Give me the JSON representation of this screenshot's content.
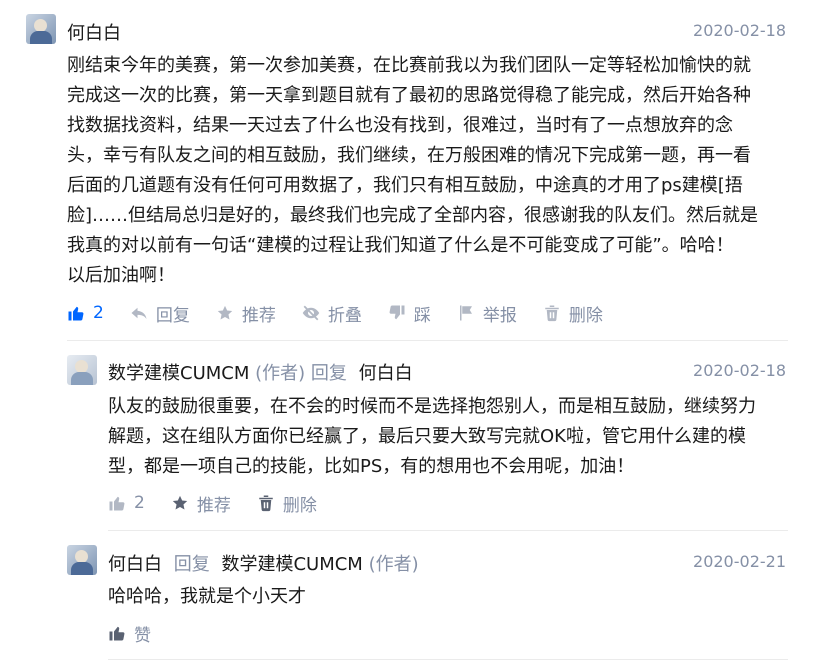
{
  "comment1": {
    "author": "何白白",
    "date": "2020-02-18",
    "lines": [
      "刚结束今年的美赛，第一次参加美赛，在比赛前我以为我们团队一定等轻松加愉快的就",
      "完成这一次的比赛，第一天拿到题目就有了最初的思路觉得稳了能完成，然后开始各种",
      "找数据找资料，结果一天过去了什么也没有找到，很难过，当时有了一点想放弃的念",
      "头，幸亏有队友之间的相互鼓励，我们继续，在万般困难的情况下完成第一题，再一看",
      "后面的几道题有没有任何可用数据了，我们只有相互鼓励，中途真的才用了ps建模[捂",
      "脸]……但结局总归是好的，最终我们也完成了全部内容，很感谢我的队友们。然后就是",
      "我真的对以前有一句话“建模的过程让我们知道了什么是不可能变成了可能”。哈哈！",
      "以后加油啊！"
    ],
    "like_count": "2",
    "reply_label": "回复",
    "recommend_label": "推荐",
    "fold_label": "折叠",
    "dislike_label": "踩",
    "report_label": "举报",
    "delete_label": "删除"
  },
  "reply1": {
    "author": "数学建模CUMCM",
    "author_tag": "(作者)",
    "reply_word": "回复",
    "target": "何白白",
    "date": "2020-02-18",
    "lines": [
      "队友的鼓励很重要，在不会的时候而不是选择抱怨别人，而是相互鼓励，继续努力",
      "解题，这在组队方面你已经赢了，最后只要大致写完就OK啦，管它用什么建的模",
      "型，都是一项自己的技能，比如PS，有的想用也不会用呢，加油！"
    ],
    "like_count": "2",
    "recommend_label": "推荐",
    "delete_label": "删除"
  },
  "reply2": {
    "author": "何白白",
    "reply_word": "回复",
    "target": "数学建模CUMCM",
    "target_tag": "(作者)",
    "date": "2020-02-21",
    "text": "哈哈哈，我就是个小天才",
    "like_label": "赞"
  }
}
